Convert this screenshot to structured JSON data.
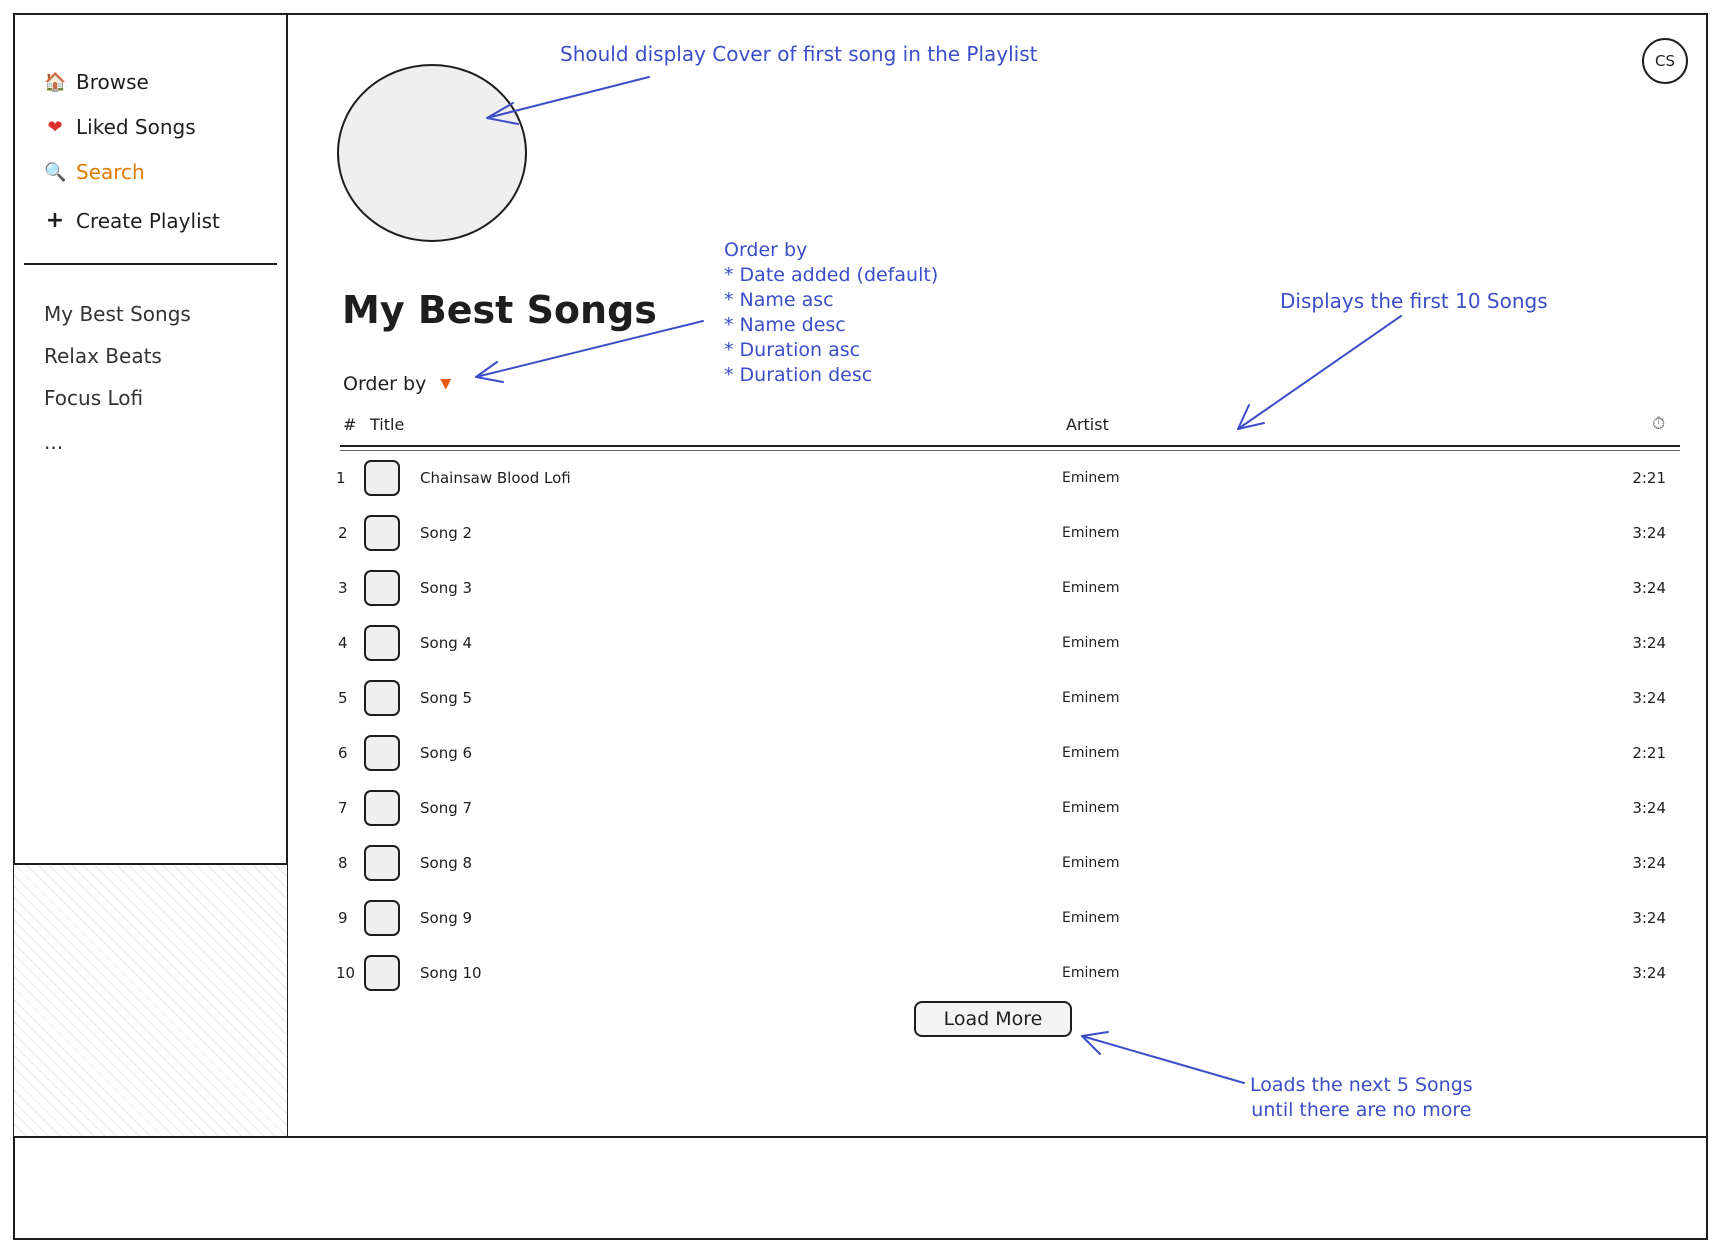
{
  "sidebar": {
    "nav": [
      {
        "icon": "home-icon",
        "label": "Browse"
      },
      {
        "icon": "heart-icon",
        "label": "Liked Songs"
      },
      {
        "icon": "search-icon",
        "label": "Search"
      },
      {
        "icon": "plus-icon",
        "label": "Create Playlist"
      }
    ],
    "playlists": [
      "My Best Songs",
      "Relax Beats",
      "Focus Lofi",
      "..."
    ]
  },
  "header": {
    "avatar_initials": "CS"
  },
  "playlist": {
    "title": "My Best Songs",
    "order_label": "Order by",
    "columns": {
      "number": "#",
      "title": "Title",
      "artist": "Artist"
    },
    "songs": [
      {
        "num": "1",
        "title": "Chainsaw Blood Lofi",
        "artist": "Eminem",
        "duration": "2:21"
      },
      {
        "num": "2",
        "title": "Song 2",
        "artist": "Eminem",
        "duration": "3:24"
      },
      {
        "num": "3",
        "title": "Song 3",
        "artist": "Eminem",
        "duration": "3:24"
      },
      {
        "num": "4",
        "title": "Song 4",
        "artist": "Eminem",
        "duration": "3:24"
      },
      {
        "num": "5",
        "title": "Song 5",
        "artist": "Eminem",
        "duration": "3:24"
      },
      {
        "num": "6",
        "title": "Song 6",
        "artist": "Eminem",
        "duration": "2:21"
      },
      {
        "num": "7",
        "title": "Song 7",
        "artist": "Eminem",
        "duration": "3:24"
      },
      {
        "num": "8",
        "title": "Song 8",
        "artist": "Eminem",
        "duration": "3:24"
      },
      {
        "num": "9",
        "title": "Song 9",
        "artist": "Eminem",
        "duration": "3:24"
      },
      {
        "num": "10",
        "title": "Song 10",
        "artist": "Eminem",
        "duration": "3:24"
      }
    ],
    "load_more_label": "Load More"
  },
  "annotations": {
    "cover": "Should display Cover of first song in the Playlist",
    "order_title": "Order by",
    "order_options": [
      "Date added (default)",
      "Name asc",
      "Name desc",
      "Duration asc",
      "Duration desc"
    ],
    "first10": "Displays the first 10 Songs",
    "load_more_line1": "Loads the next 5 Songs",
    "load_more_line2": "until there are no more"
  },
  "colors": {
    "annotation": "#3b4ec8",
    "search_active": "#e07b00",
    "heart": "#e03131",
    "dropdown": "#e8590c"
  }
}
